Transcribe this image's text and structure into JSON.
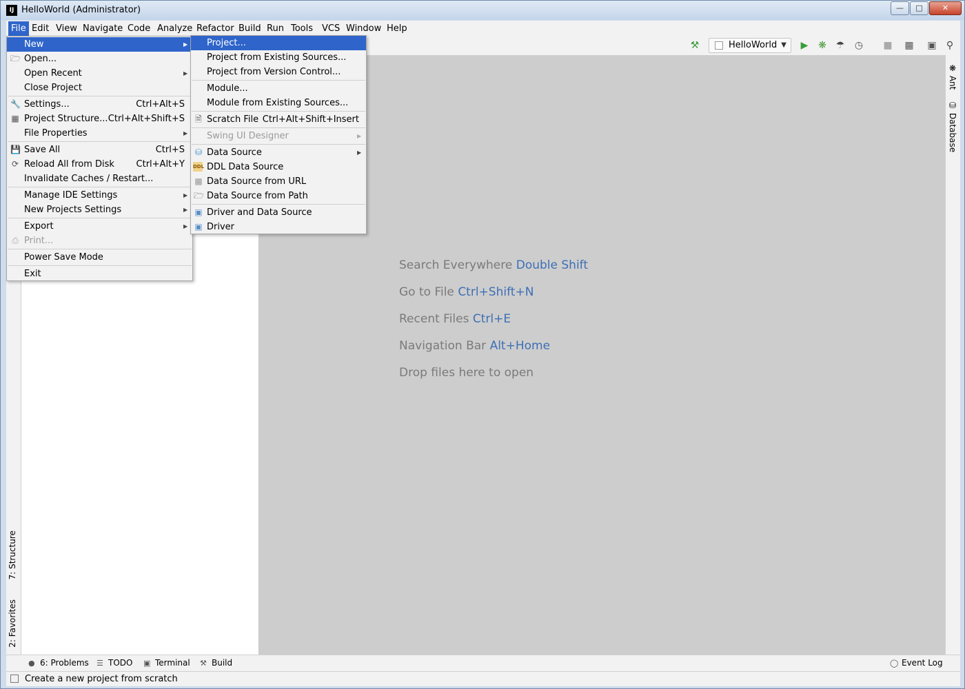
{
  "window": {
    "title": "HelloWorld (Administrator)",
    "app_icon_text": "IJ"
  },
  "menubar": {
    "items": [
      {
        "label": "File"
      },
      {
        "label": "Edit"
      },
      {
        "label": "View"
      },
      {
        "label": "Navigate"
      },
      {
        "label": "Code"
      },
      {
        "label": "Analyze"
      },
      {
        "label": "Refactor"
      },
      {
        "label": "Build"
      },
      {
        "label": "Run"
      },
      {
        "label": "Tools"
      },
      {
        "label": "VCS"
      },
      {
        "label": "Window"
      },
      {
        "label": "Help"
      }
    ]
  },
  "toolbar": {
    "run_config": "HelloWorld",
    "icons": [
      "hammer-icon",
      "run-icon",
      "debug-icon",
      "coverage-icon",
      "profile-icon",
      "stop-icon",
      "project-structure-icon",
      "terminal-icon",
      "search-icon"
    ]
  },
  "file_menu": {
    "items": [
      {
        "label": "New"
      },
      {
        "label": "Open..."
      },
      {
        "label": "Open Recent"
      },
      {
        "label": "Close Project"
      },
      {
        "label": "Settings...",
        "shortcut": "Ctrl+Alt+S"
      },
      {
        "label": "Project Structure...",
        "shortcut": "Ctrl+Alt+Shift+S"
      },
      {
        "label": "File Properties"
      },
      {
        "label": "Save All",
        "shortcut": "Ctrl+S"
      },
      {
        "label": "Reload All from Disk",
        "shortcut": "Ctrl+Alt+Y"
      },
      {
        "label": "Invalidate Caches / Restart..."
      },
      {
        "label": "Manage IDE Settings"
      },
      {
        "label": "New Projects Settings"
      },
      {
        "label": "Export"
      },
      {
        "label": "Print..."
      },
      {
        "label": "Power Save Mode"
      },
      {
        "label": "Exit"
      }
    ]
  },
  "new_submenu": {
    "items": [
      {
        "label": "Project..."
      },
      {
        "label": "Project from Existing Sources..."
      },
      {
        "label": "Project from Version Control..."
      },
      {
        "label": "Module..."
      },
      {
        "label": "Module from Existing Sources..."
      },
      {
        "label": "Scratch File",
        "shortcut": "Ctrl+Alt+Shift+Insert"
      },
      {
        "label": "Swing UI Designer"
      },
      {
        "label": "Data Source"
      },
      {
        "label": "DDL Data Source",
        "icon_text": "DDL"
      },
      {
        "label": "Data Source from URL"
      },
      {
        "label": "Data Source from Path"
      },
      {
        "label": "Driver and Data Source"
      },
      {
        "label": "Driver"
      }
    ]
  },
  "editor_hints": [
    {
      "text": "Search Everywhere ",
      "key": "Double Shift"
    },
    {
      "text": "Go to File ",
      "key": "Ctrl+Shift+N"
    },
    {
      "text": "Recent Files ",
      "key": "Ctrl+E"
    },
    {
      "text": "Navigation Bar ",
      "key": "Alt+Home"
    },
    {
      "text": "Drop files here to open",
      "key": ""
    }
  ],
  "left_strip": {
    "structure": "7: Structure",
    "favorites": "2: Favorites"
  },
  "right_strip": {
    "ant": "Ant",
    "database": "Database"
  },
  "bottombar": {
    "problems": "6: Problems",
    "todo": "TODO",
    "terminal": "Terminal",
    "build": "Build",
    "event_log": "Event Log"
  },
  "statusbar": {
    "text": "Create a new project from scratch"
  },
  "colors": {
    "selection": "#2f65ca",
    "editor_bg": "#cdcdcd",
    "hint_text": "#7a7a7a",
    "hint_key": "#3d6fb5"
  }
}
